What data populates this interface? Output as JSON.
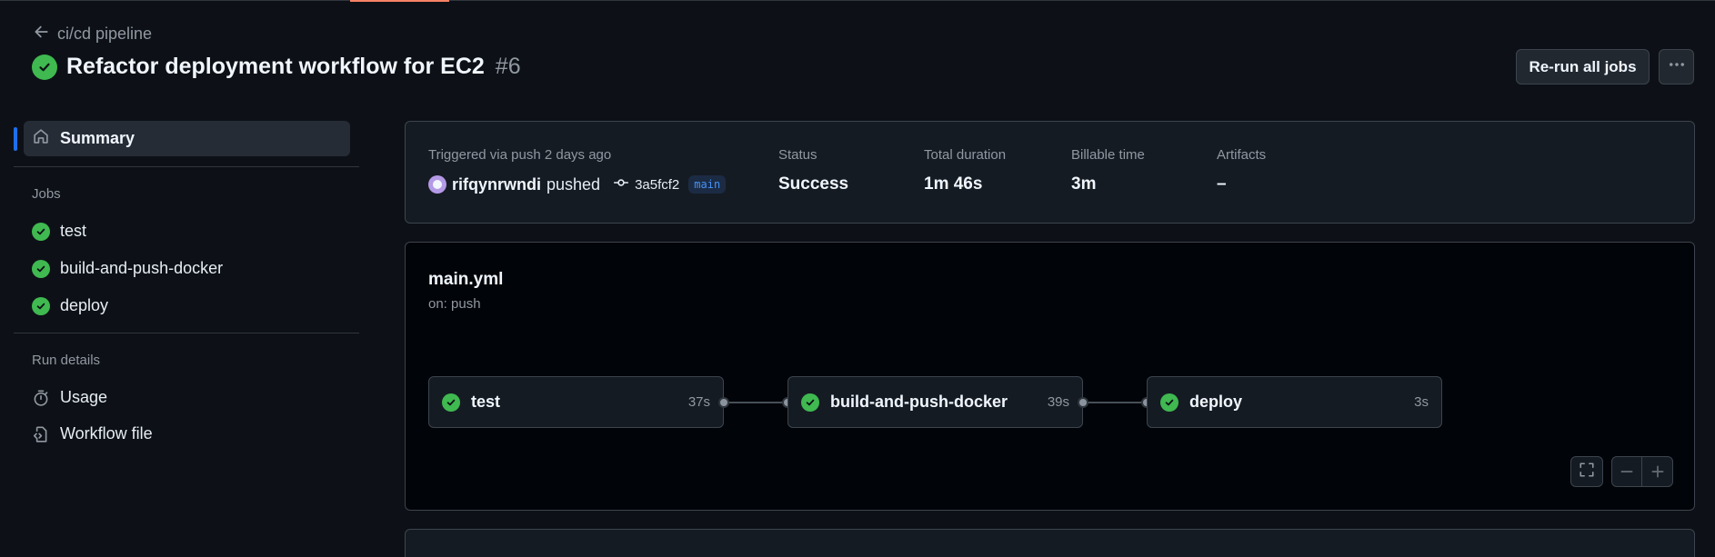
{
  "header": {
    "back_label": "ci/cd pipeline",
    "title": "Refactor deployment workflow for EC2",
    "run_number": "#6",
    "rerun_label": "Re-run all jobs"
  },
  "sidebar": {
    "summary_label": "Summary",
    "jobs_heading": "Jobs",
    "jobs": [
      {
        "label": "test"
      },
      {
        "label": "build-and-push-docker"
      },
      {
        "label": "deploy"
      }
    ],
    "run_details_heading": "Run details",
    "details": [
      {
        "label": "Usage",
        "icon": "stopwatch-icon"
      },
      {
        "label": "Workflow file",
        "icon": "file-code-icon"
      }
    ]
  },
  "summary": {
    "trigger_label": "Triggered via push 2 days ago",
    "user": "rifqynrwndi",
    "action": "pushed",
    "commit": "3a5fcf2",
    "branch": "main",
    "status_label": "Status",
    "status_value": "Success",
    "duration_label": "Total duration",
    "duration_value": "1m 46s",
    "billable_label": "Billable time",
    "billable_value": "3m",
    "artifacts_label": "Artifacts",
    "artifacts_value": "–"
  },
  "workflow": {
    "file": "main.yml",
    "trigger": "on: push",
    "jobs": [
      {
        "name": "test",
        "duration": "37s"
      },
      {
        "name": "build-and-push-docker",
        "duration": "39s"
      },
      {
        "name": "deploy",
        "duration": "3s"
      }
    ]
  },
  "colors": {
    "success": "#3fb950",
    "accent": "#1f6feb",
    "branch": "#4493f8"
  }
}
